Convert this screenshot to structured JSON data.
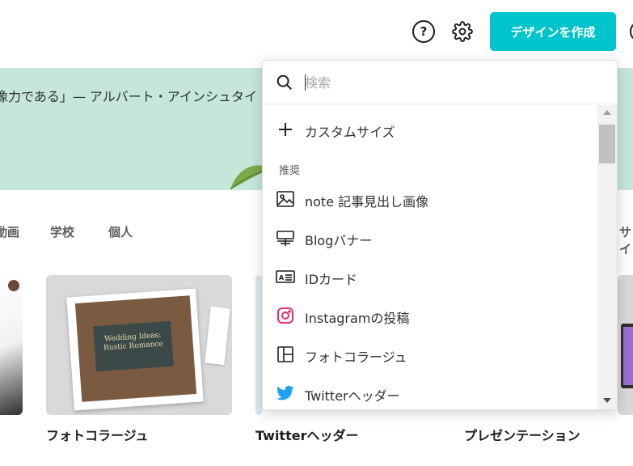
{
  "header": {
    "help_symbol": "?",
    "create_button": "デザインを作成"
  },
  "banner": {
    "quote": "像力である」— アルバート・アインシュタイ"
  },
  "categories": [
    "動画",
    "学校",
    "個人",
    "サイ"
  ],
  "cards": [
    {
      "label": "フォトコラージュ",
      "thumb_title": "Wedding Ideas: Rustic Romance"
    },
    {
      "label": "Twitterヘッダー"
    },
    {
      "label": "プレゼンテーション"
    }
  ],
  "dropdown": {
    "search_placeholder": "検索",
    "custom_size": "カスタムサイズ",
    "section_recommended": "推奨",
    "items": [
      {
        "label": "note 記事見出し画像",
        "icon": "image-icon"
      },
      {
        "label": "Blogバナー",
        "icon": "banner-icon"
      },
      {
        "label": "IDカード",
        "icon": "id-card-icon"
      },
      {
        "label": "Instagramの投稿",
        "icon": "instagram-icon"
      },
      {
        "label": "フォトコラージュ",
        "icon": "collage-icon"
      },
      {
        "label": "Twitterヘッダー",
        "icon": "twitter-icon"
      }
    ]
  },
  "colors": {
    "accent": "#00c4cc",
    "banner_bg": "#c6e6da",
    "instagram": "#e1306c",
    "twitter": "#1da1f2"
  }
}
